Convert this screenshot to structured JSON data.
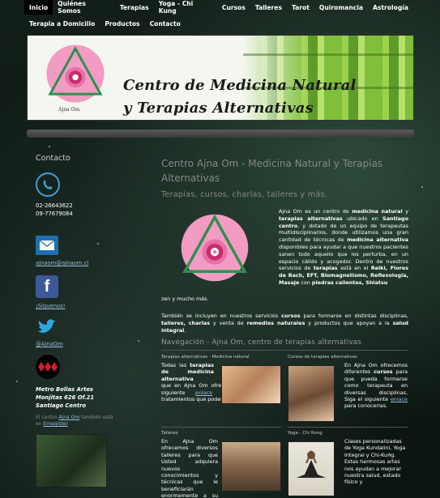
{
  "nav": {
    "row1": [
      "Inicio",
      "Quiénes Somos",
      "Terapias",
      "Yoga - Chi Kung",
      "Cursos",
      "Talleres",
      "Tarot",
      "Quiromancia",
      "Astrología"
    ],
    "row2": [
      "Terapia a Domicilio",
      "Productos",
      "Contacto"
    ]
  },
  "banner": {
    "logo_text": "Ajna Om",
    "title_line1": "Centro de Medicina Natural",
    "title_line2": "y Terapias Alternativas"
  },
  "sidebar": {
    "heading": "Contacto",
    "phone1": "02-26643622",
    "phone2": "09-77679084",
    "email": "ajnaom@ajnaom.cl",
    "facebook": "¡Síguenos!",
    "twitter": "@AjnaOm",
    "metro_line1": "Metro Bellas Artes",
    "metro_line2": "Monjitas 626 Of.21",
    "metro_line3": "Santiago Centro",
    "magister_pre": "El centro ",
    "magister_link1": "Ajna Om",
    "magister_mid": " también está en ",
    "magister_link2": "Emagister"
  },
  "main": {
    "title": "Centro Ajna Om - Medicina Natural y Terapias Alternativas",
    "subtitle": "Terapias, cursos, charlas, talleres y más.",
    "intro": {
      "t1": "Ajna Om es un centro de ",
      "b1": "medicina natural",
      "t2": " y ",
      "b2": "terapias alternativas",
      "t3": " ubicado en ",
      "b3": "Santiago centro",
      "t4": ", y dotado de un equipo de terapeutas multidisciplinarios, donde utilizamos una gran cantidad de técnicas de ",
      "b4": "medicina alternativa",
      "t5": " disponibles para ayudar a que nuestros pacientes sanen todo aquello que los perturba, en un espacio cálido y acogedor. Dentro de nuestros servicios de ",
      "b5": "terapias",
      "t6": " está en el ",
      "b6": "Reiki, Flores de Bach, EFT, Biomagnetismo, Reflexología, Masaje",
      "t7": " con ",
      "b7": "piedras calientes, Shiatsu"
    },
    "intro_end": "zen y mucho más.",
    "p3": {
      "t1": "También se incluyen en nuestros servicios ",
      "b1": "cursos",
      "t2": " para formarse en distintas disciplinas, ",
      "b2": "talleres, charlas",
      "t3": " y venta de ",
      "b3": "remedios naturales",
      "t4": " y productos que apoyan a la ",
      "b4": "salud integral",
      "t5": "."
    },
    "nav_heading": "Navegación - Ajna Om, centro de terapias alternativas",
    "cards": [
      {
        "title": "Terapias alternativas - Medicina natural",
        "pre": "Todas las ",
        "b": "terapias de medicina alternativa",
        "post": " que en Ajna Om ofrecemos. Entre en el siguiente ",
        "link": "enlace",
        "end": " y conozca los tratamientos que podemos entregarle."
      },
      {
        "title": "Cursos de terapias alternativas",
        "pre": "En Ajna Om ofrecemos diferentes ",
        "b": "cursos",
        "post": " para que pueda formarse como terapeuta en diversas disciplinas. Siga el siguiente ",
        "link": "enlace",
        "end": " para conocerlas."
      },
      {
        "title": "Talleres",
        "pre": "En Ajna Om ofrecemos diversos talleres para que Usted adquiera nuevos conocimientos y técnicas que le beneficiarán enormemente a su bienestar",
        "b": "",
        "post": "",
        "link": "",
        "end": ""
      },
      {
        "title": "Yoga - Chi Kung",
        "pre": "Clases personalizadas de Yoga Kundalini, Yoga Integral y Chi-Kung. Estas hermosas artes nos ayudan a mejorar nuestra salud, estado físico y",
        "b": "",
        "post": "",
        "link": "",
        "end": ""
      }
    ]
  }
}
